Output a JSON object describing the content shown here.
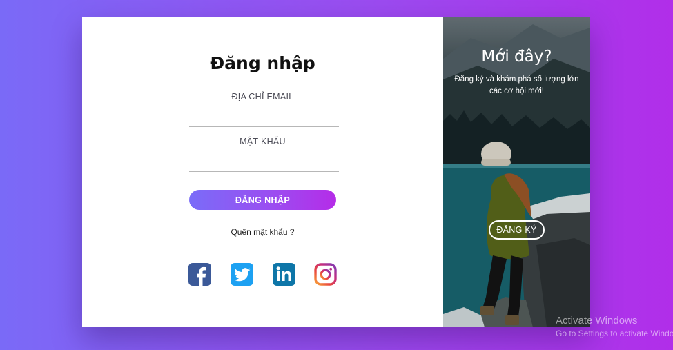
{
  "login": {
    "title": "Đăng nhập",
    "email_label": "ĐỊA CHỈ EMAIL",
    "email_value": "",
    "password_label": "MẬT KHẨU",
    "password_value": "",
    "login_button": "ĐĂNG NHẬP",
    "forgot_link": "Quên mật khẩu ?",
    "social_icons": [
      "facebook-icon",
      "twitter-icon",
      "linkedin-icon",
      "instagram-icon"
    ]
  },
  "signup_panel": {
    "title": "Mới đây?",
    "description": "Đăng ký và khám phá số lượng lớn các cơ hội mới!",
    "register_button": "ĐĂNG KÝ"
  },
  "watermark": {
    "line1": "Activate Windows",
    "line2": "Go to Settings to activate Windows."
  },
  "colors": {
    "background_start": "#7a6af7",
    "background_end": "#b12ee9",
    "facebook": "#3b5998",
    "twitter": "#1da1f2",
    "linkedin": "#0e76a8"
  }
}
